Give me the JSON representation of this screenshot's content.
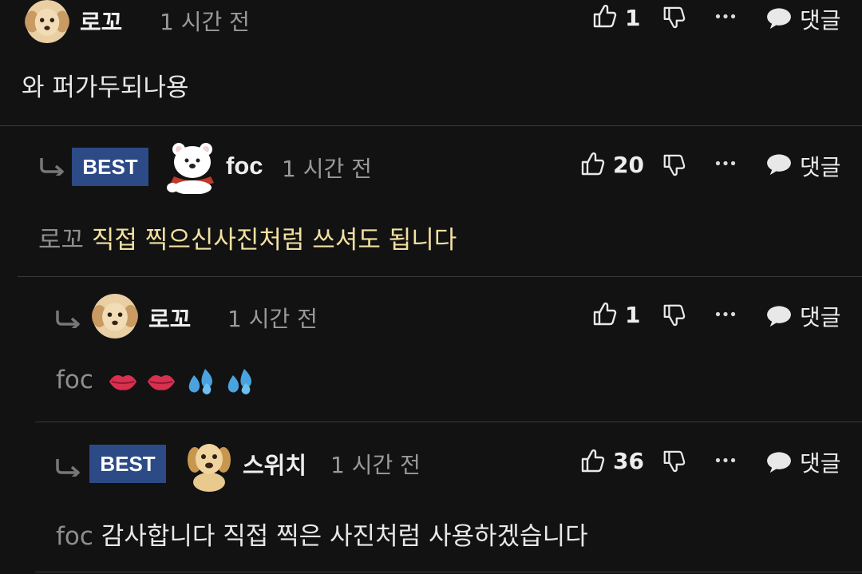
{
  "comments": [
    {
      "author": "로꼬",
      "time": "1 시간 전",
      "likes": "1",
      "reply_label": "댓글",
      "text": "와 퍼가두되나용"
    },
    {
      "best": "BEST",
      "author": "foc",
      "time": "1 시간 전",
      "likes": "20",
      "reply_label": "댓글",
      "mention": "로꼬",
      "text": "직접 찍으신사진처럼 쓰셔도 됩니다"
    },
    {
      "author": "로꼬",
      "time": "1 시간 전",
      "likes": "1",
      "reply_label": "댓글",
      "mention": "foc",
      "emojis": [
        "lips-icon",
        "lips-icon",
        "sweat-droplets-icon",
        "sweat-droplets-icon"
      ]
    },
    {
      "best": "BEST",
      "author": "스위치",
      "time": "1 시간 전",
      "likes": "36",
      "reply_label": "댓글",
      "mention": "foc",
      "text": "감사합니다 직접 찍은 사진처럼 사용하겠습니다"
    }
  ],
  "colors": {
    "background": "#121212",
    "best_badge": "#2c4a86",
    "highlight_text": "#f2e1a2",
    "divider": "#3a3a3a"
  }
}
